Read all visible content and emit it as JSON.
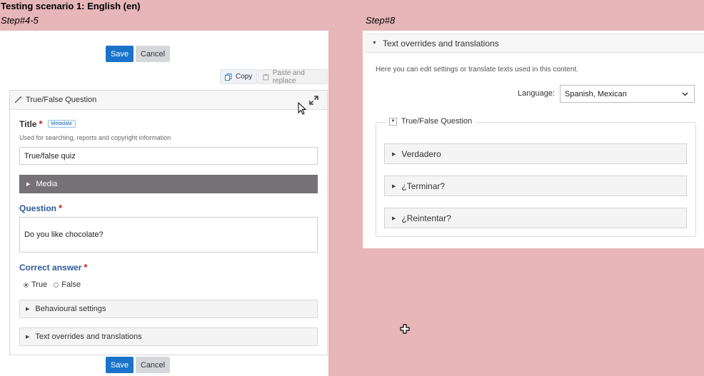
{
  "header": {
    "title": "Testing scenario 1: English (en)",
    "step_left": "Step#4-5",
    "step_right": "Step#8"
  },
  "editor": {
    "save_label": "Save",
    "cancel_label": "Cancel",
    "copy_label": "Copy",
    "paste_label": "Paste and replace",
    "content_type": "True/False Question",
    "title_label": "Title",
    "metadata_badge": "Metadata",
    "title_desc": "Used for searching, reports and copyright information",
    "title_value": "True/false quiz",
    "media_label": "Media",
    "question_label": "Question",
    "question_value": "Do you like chocolate?",
    "correct_answer_label": "Correct answer",
    "options": [
      "True",
      "False"
    ],
    "selected_option": "True",
    "behavioural_label": "Behavioural settings",
    "overrides_label": "Text overrides and translations"
  },
  "translations": {
    "section_title": "Text overrides and translations",
    "description": "Here you can edit settings or translate texts used in this content.",
    "language_label": "Language:",
    "language_value": "Spanish, Mexican",
    "group_title": "True/False Question",
    "items": [
      "Verdadero",
      "¿Terminar?",
      "¿Reintentar?"
    ]
  },
  "colors": {
    "background": "#e6b6b8",
    "save_button": "#1a73c9",
    "media_bar": "#767175",
    "required": "#c81e1e",
    "label_blue": "#2d5b9e"
  },
  "icons": [
    "copy-icon",
    "paste-icon",
    "wand-icon",
    "fullscreen-icon",
    "chevron-down-icon",
    "triangle-right-icon",
    "triangle-down-icon",
    "mouse-pointer-icon",
    "crosshair-cursor-icon"
  ]
}
